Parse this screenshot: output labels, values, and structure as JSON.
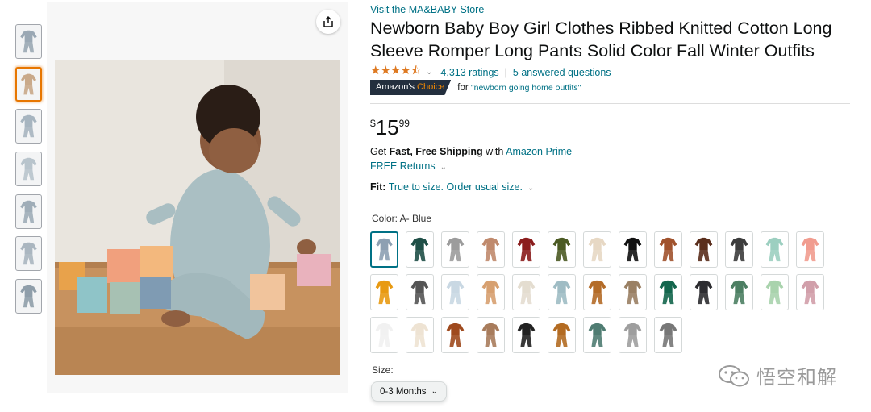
{
  "product": {
    "store_link": "Visit the MA&BABY Store",
    "title": "Newborn Baby Boy Girl Clothes Ribbed Knitted Cotton Long Sleeve Romper Long Pants Solid Color Fall Winter Outfits",
    "rating_stars": 4.5,
    "stars_glyphs": "★★★★⯪",
    "ratings_count": "4,313 ratings",
    "answered_questions": "5 answered questions",
    "badge": {
      "prefix": "Amazon's ",
      "highlight": "Choice",
      "for_text": "for",
      "query": "\"newborn going home outfits\""
    },
    "price": {
      "currency": "$",
      "whole": "15",
      "fraction": "99"
    },
    "shipping": {
      "pre": "Get ",
      "fast": "Fast, Free Shipping",
      "mid": " with ",
      "prime": "Amazon Prime"
    },
    "returns": "FREE Returns",
    "fit": {
      "label": "Fit:",
      "value": "True to size. Order usual size."
    },
    "color_label": "Color: A- Blue",
    "size_label": "Size:",
    "size_selected": "0-3 Months"
  },
  "thumbnails": [
    {
      "color": "#9aa8b4",
      "active": false
    },
    {
      "color": "#c9a98a",
      "active": true
    },
    {
      "color": "#a7b5c0",
      "active": false
    },
    {
      "color": "#b8c4cc",
      "active": false
    },
    {
      "color": "#9fadb8",
      "active": false
    },
    {
      "color": "#aab6c0",
      "active": false
    },
    {
      "color": "#8f9eaa",
      "active": false
    }
  ],
  "colors": [
    "#8da0b2",
    "#1f4f47",
    "#9c9c9c",
    "#c08a6d",
    "#8b1d1d",
    "#4b5a23",
    "#e7d8c4",
    "#111111",
    "#a0522d",
    "#5a2e1c",
    "#3c3c3c",
    "#9ccfc0",
    "#f19c8f",
    "#e89a12",
    "#555555",
    "#c9d8e3",
    "#d7a070",
    "#e4ddd0",
    "#9fbcc4",
    "#b46c28",
    "#9a8064",
    "#13664d",
    "#2c2c30",
    "#4d7f63",
    "#a9d3ad",
    "#d19faa",
    "#f1f1f1",
    "#eee3d3",
    "#9f4a1e",
    "#a87c5c",
    "#222222",
    "#b36b22",
    "#4f7c72",
    "#9e9e9e",
    "#777777"
  ],
  "watermark": "悟空和解",
  "accent": "#e77600",
  "link_color": "#007185"
}
